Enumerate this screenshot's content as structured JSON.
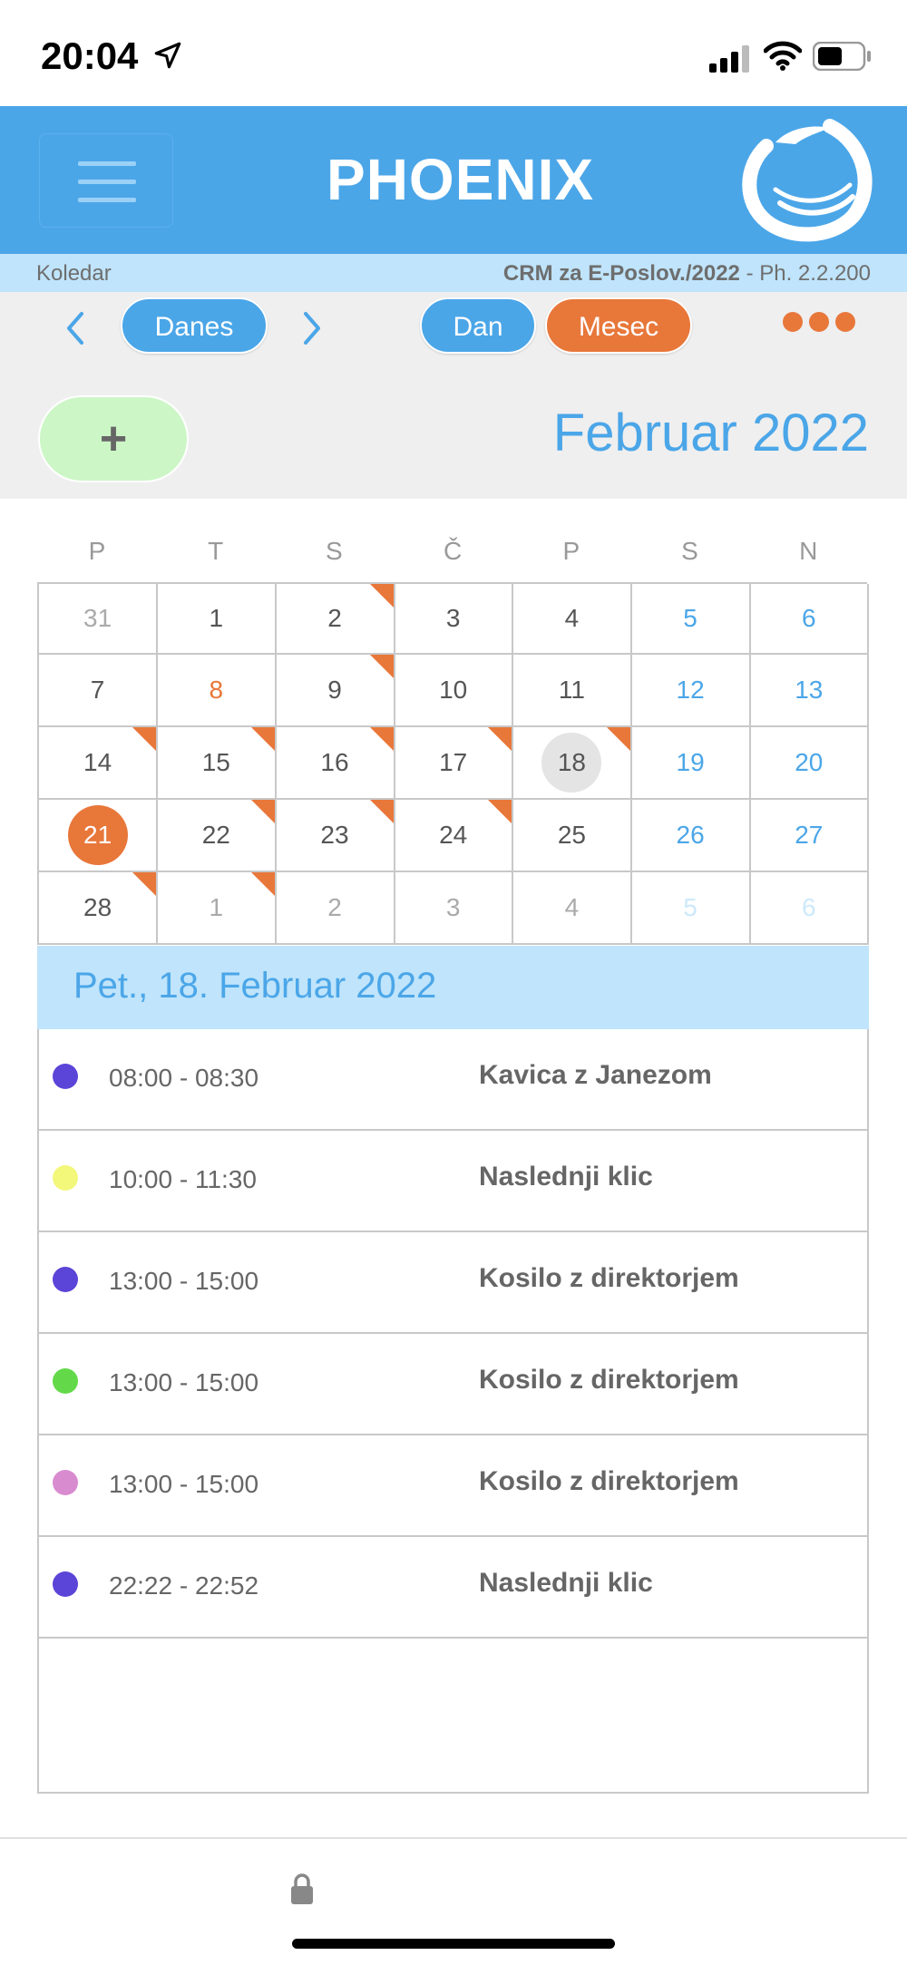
{
  "status": {
    "time": "20:04"
  },
  "header": {
    "title": "PHOENIX"
  },
  "infobar": {
    "left": "Koledar",
    "product": "CRM za E-Poslov./2022",
    "version": " - Ph. 2.2.200"
  },
  "toolbar": {
    "today_label": "Danes",
    "day_label": "Dan",
    "month_label": "Mesec",
    "prev_glyph": "‹",
    "next_glyph": "›",
    "add_glyph": "+"
  },
  "calendar": {
    "month_title": "Februar 2022",
    "weekdays": [
      "P",
      "T",
      "S",
      "Č",
      "P",
      "S",
      "N"
    ],
    "weeks": [
      [
        {
          "d": "31",
          "s": "other"
        },
        {
          "d": "1"
        },
        {
          "d": "2",
          "f": 1
        },
        {
          "d": "3"
        },
        {
          "d": "4"
        },
        {
          "d": "5",
          "s": "weekend"
        },
        {
          "d": "6",
          "s": "weekend"
        }
      ],
      [
        {
          "d": "7"
        },
        {
          "d": "8",
          "s": "holiday"
        },
        {
          "d": "9",
          "f": 1
        },
        {
          "d": "10"
        },
        {
          "d": "11"
        },
        {
          "d": "12",
          "s": "weekend"
        },
        {
          "d": "13",
          "s": "weekend"
        }
      ],
      [
        {
          "d": "14",
          "f": 1
        },
        {
          "d": "15",
          "f": 1
        },
        {
          "d": "16",
          "f": 1
        },
        {
          "d": "17",
          "f": 1
        },
        {
          "d": "18",
          "f": 1,
          "s": "today"
        },
        {
          "d": "19",
          "s": "weekend"
        },
        {
          "d": "20",
          "s": "weekend"
        }
      ],
      [
        {
          "d": "21",
          "s": "selected"
        },
        {
          "d": "22",
          "f": 1
        },
        {
          "d": "23",
          "f": 1
        },
        {
          "d": "24",
          "f": 1
        },
        {
          "d": "25"
        },
        {
          "d": "26",
          "s": "weekend"
        },
        {
          "d": "27",
          "s": "weekend"
        }
      ],
      [
        {
          "d": "28",
          "f": 1
        },
        {
          "d": "1",
          "f": 1,
          "s": "other"
        },
        {
          "d": "2",
          "s": "other"
        },
        {
          "d": "3",
          "s": "other"
        },
        {
          "d": "4",
          "s": "other"
        },
        {
          "d": "5",
          "s": "other-weekend"
        },
        {
          "d": "6",
          "s": "other-weekend"
        }
      ]
    ]
  },
  "colors": {
    "accent": "#4ba6e8",
    "orange": "#e8773a",
    "holiday": "#e8773a",
    "weekend": "#4ba6e8",
    "other": "#aaaaaa",
    "other_weekend": "#cde9fb",
    "normal": "#555555"
  },
  "day": {
    "title": "Pet., 18. Februar 2022",
    "events": [
      {
        "time": "08:00 - 08:30",
        "title": "Kavica z Janezom",
        "color": "#5b44d8"
      },
      {
        "time": "10:00 - 11:30",
        "title": "Naslednji klic",
        "color": "#f3f77a"
      },
      {
        "time": "13:00 - 15:00",
        "title": "Kosilo z direktorjem",
        "color": "#5b44d8"
      },
      {
        "time": "13:00 - 15:00",
        "title": "Kosilo z direktorjem",
        "color": "#63d94a"
      },
      {
        "time": "13:00 - 15:00",
        "title": "Kosilo z direktorjem",
        "color": "#d98bd0"
      },
      {
        "time": "22:22 - 22:52",
        "title": "Naslednji klic",
        "color": "#5b44d8"
      }
    ]
  }
}
